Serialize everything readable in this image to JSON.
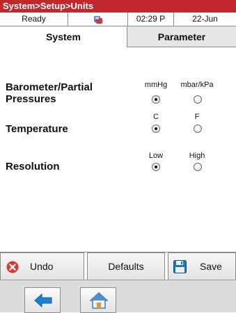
{
  "title": "System>Setup>Units",
  "status": {
    "state": "Ready",
    "time": "02:29 P",
    "date": "22-Jun"
  },
  "tabs": [
    {
      "label": "System"
    },
    {
      "label": "Parameter"
    }
  ],
  "settings": [
    {
      "label": "Barometer/Partial Pressures",
      "options": [
        "mmHg",
        "mbar/kPa"
      ],
      "selected": "mmHg"
    },
    {
      "label": "Temperature",
      "options": [
        "C",
        "F"
      ],
      "selected": "C"
    },
    {
      "label": "Resolution",
      "options": [
        "Low",
        "High"
      ],
      "selected": "Low"
    }
  ],
  "buttons": {
    "undo": "Undo",
    "defaults": "Defaults",
    "save": "Save"
  },
  "icons": {
    "status": "sync-icon",
    "undo": "cancel-icon",
    "save": "floppy-disk-icon",
    "back": "back-arrow-icon",
    "home": "home-icon"
  },
  "colors": {
    "titlebar": "#c0282e",
    "accent": "#1a76c8",
    "cancel": "#d9392f"
  }
}
